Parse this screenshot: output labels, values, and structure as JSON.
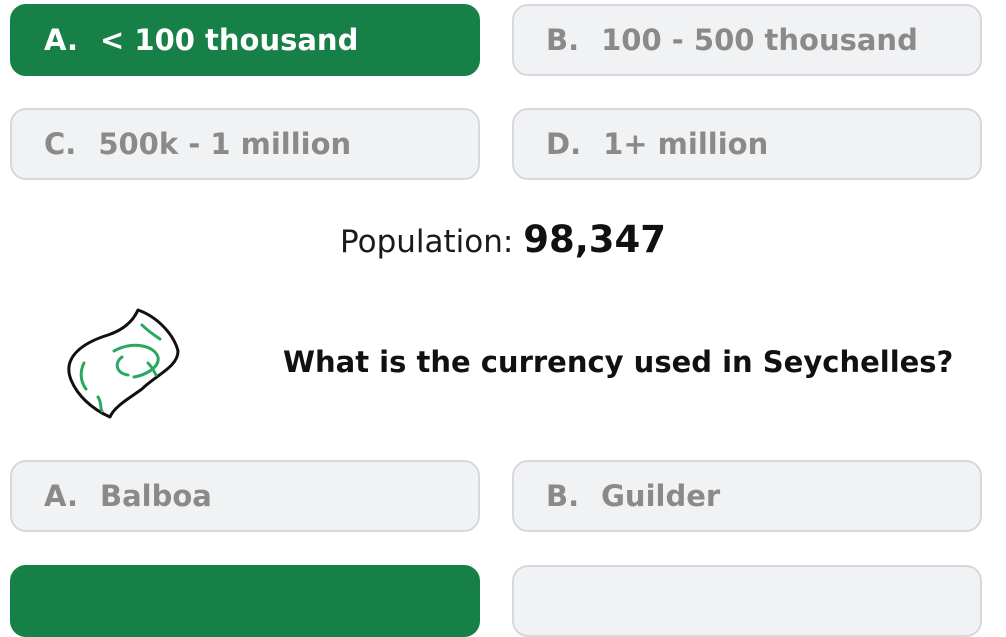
{
  "population_question": {
    "options": [
      {
        "letter": "A.",
        "text": "< 100 thousand",
        "selected": true
      },
      {
        "letter": "B.",
        "text": "100 - 500 thousand",
        "selected": false
      },
      {
        "letter": "C.",
        "text": "500k - 1 million",
        "selected": false
      },
      {
        "letter": "D.",
        "text": "1+ million",
        "selected": false
      }
    ]
  },
  "population": {
    "label": "Population:",
    "value": "98,347"
  },
  "currency_question": {
    "icon": "money-bill-icon",
    "text": "What is the currency used in Seychelles?",
    "options": [
      {
        "letter": "A.",
        "text": "Balboa",
        "selected": false
      },
      {
        "letter": "B.",
        "text": "Guilder",
        "selected": false
      },
      {
        "letter": "",
        "text": "",
        "selected": true
      },
      {
        "letter": "",
        "text": "",
        "selected": false
      }
    ]
  },
  "colors": {
    "selected": "#168047",
    "unselected_bg": "#f1f2f4",
    "unselected_text": "#8a8a8a",
    "icon_accent": "#2aa860"
  }
}
